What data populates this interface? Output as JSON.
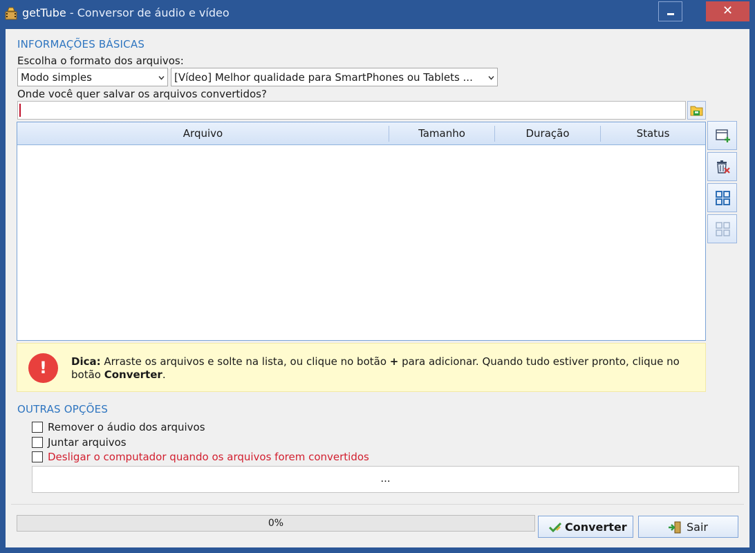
{
  "window": {
    "title_app": "getTube",
    "title_rest": " - Conversor de áudio e vídeo",
    "minimize_glyph": "minimize-icon",
    "close_glyph": "✕"
  },
  "basic": {
    "section_title": "INFORMAÇÕES BÁSICAS",
    "format_label": "Escolha o formato dos arquivos:",
    "mode_value": "Modo simples",
    "format_value": "[Vídeo] Melhor qualidade para SmartPhones ou Tablets ...",
    "save_label": "Onde você quer salvar os arquivos convertidos?",
    "save_path": ""
  },
  "file_table": {
    "columns": [
      "Arquivo",
      "Tamanho",
      "Duração",
      "Status"
    ],
    "rows": []
  },
  "side_buttons": [
    {
      "icon": "add-file-icon"
    },
    {
      "icon": "clear-list-icon"
    },
    {
      "icon": "select-all-icon"
    },
    {
      "icon": "deselect-all-icon"
    }
  ],
  "tip": {
    "bold_prefix": "Dica:",
    "text_part1": " Arraste os arquivos e solte na lista, ou clique no botão ",
    "plus": "+",
    "text_part2": " para adicionar. Quando tudo estiver pronto, clique no botão ",
    "convert_word": "Converter",
    "end": "."
  },
  "other": {
    "section_title": "OUTRAS OPÇÕES",
    "options": [
      {
        "label": "Remover o áudio dos arquivos",
        "checked": false
      },
      {
        "label": "Juntar arquivos",
        "checked": false
      },
      {
        "label": "Desligar o computador quando os arquivos forem convertidos",
        "checked": false
      }
    ],
    "more_label": "..."
  },
  "footer": {
    "progress_value": 0,
    "progress_text": "0%",
    "convert_label": "Converter",
    "exit_label": "Sair"
  },
  "colors": {
    "titlebar": "#2b5797",
    "section_title": "#2e75c0",
    "warning_text": "#d21f2f",
    "tip_background": "#fffbcf",
    "close_button": "#c75050"
  }
}
